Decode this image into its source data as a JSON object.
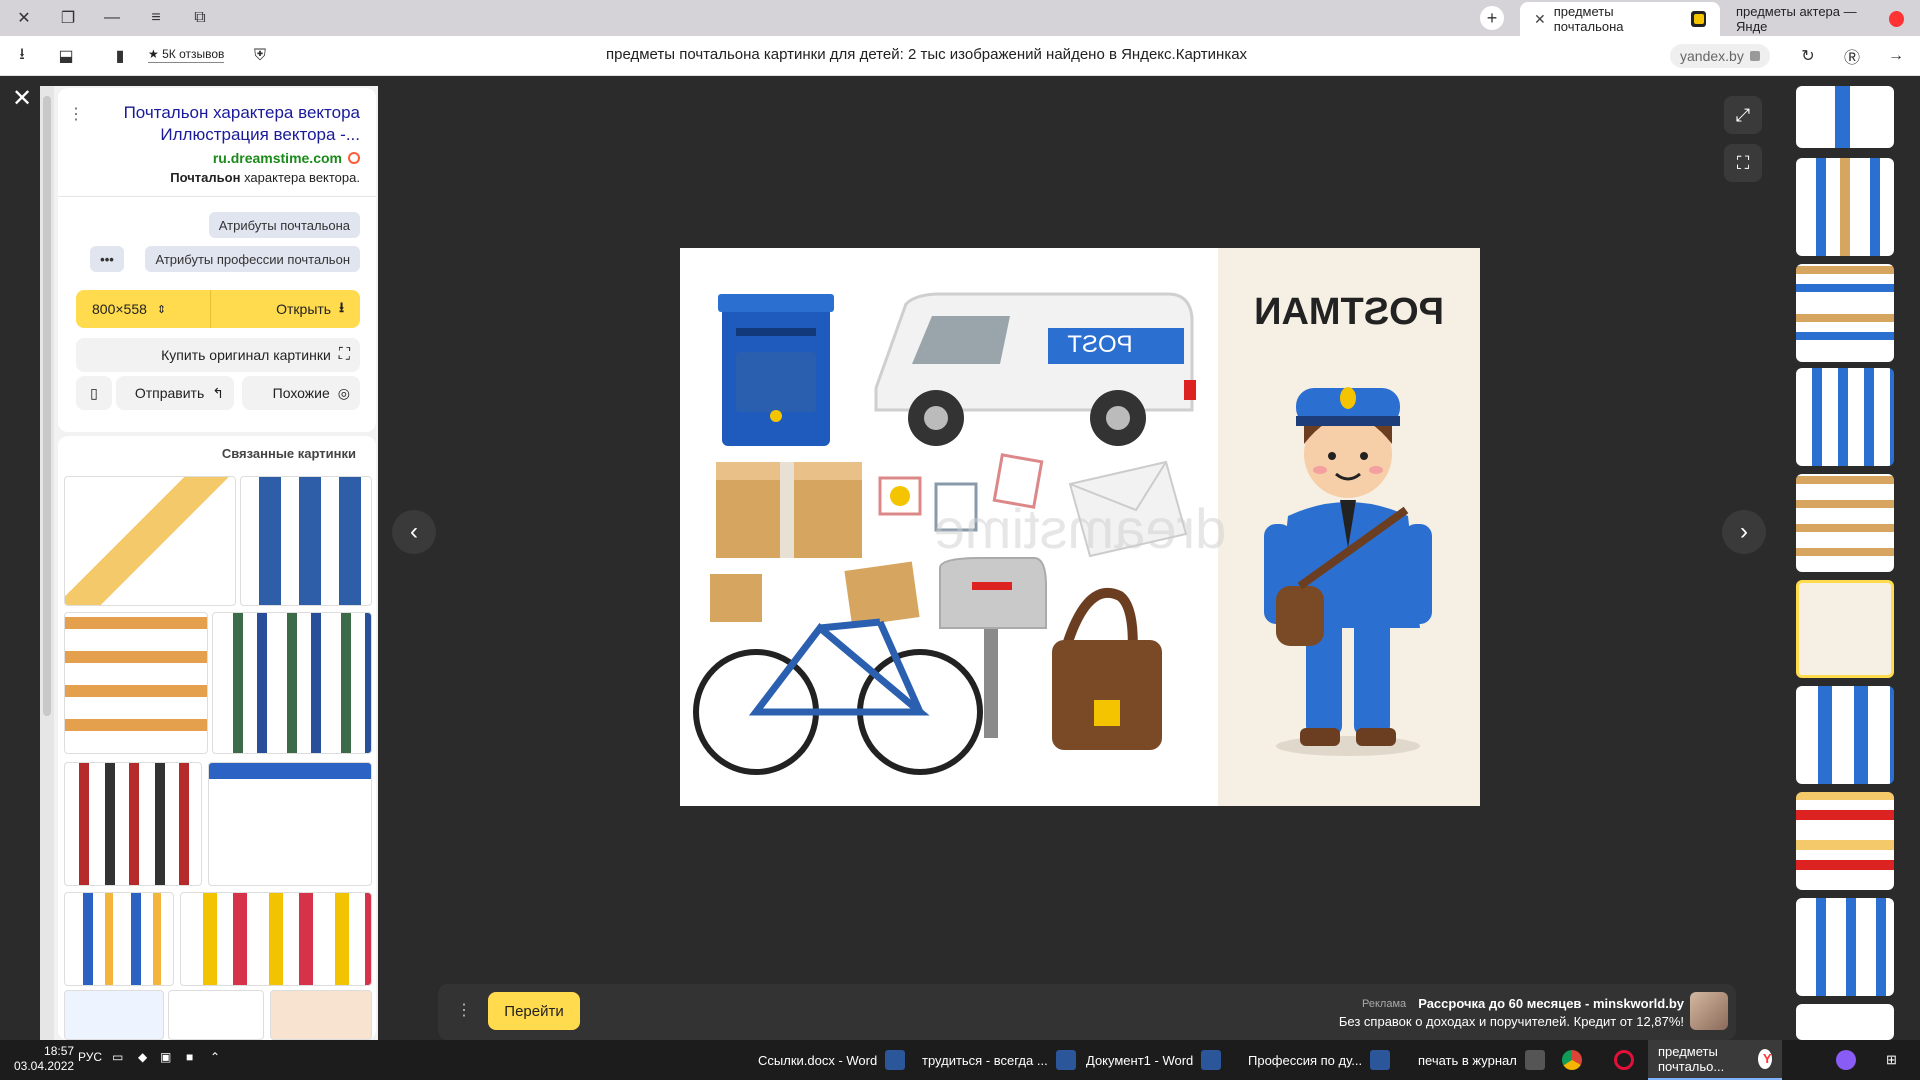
{
  "browser": {
    "tabs": [
      {
        "title": "предметы почтальона",
        "active": true
      },
      {
        "title": "предметы актера — Янде",
        "active": false
      }
    ],
    "page_title": "предметы почтальона картинки для детей: 2 тыс изображений найдено в Яндекс.Картинках",
    "url": "yandex.by",
    "reviews_label": "★ 5К отзывов"
  },
  "info": {
    "title": "Почтальон характера вектора Иллюстрация вектора -...",
    "source": "ru.dreamstime.com",
    "description_bold": "Почтальон",
    "description_rest": " характера вектора.",
    "tags": [
      "Атрибуты почтальона",
      "Атрибуты профессии почтальон"
    ],
    "more": "•••",
    "open_label": "Открыть",
    "size_label": "800×558",
    "buy_label": "Купить оригинал картинки",
    "similar_label": "Похожие",
    "share_label": "Отправить"
  },
  "related": {
    "title": "Связанные картинки"
  },
  "main_image": {
    "heading": "POSTMAN",
    "van_label": "POST",
    "watermark": "dreamstime"
  },
  "ad": {
    "go_label": "Перейти",
    "line1": "Рассрочка до 60 месяцев - minskworld.by",
    "tag": "Реклама",
    "line2": "Без справок о доходах и поручителей. Кредит от 12,87%!"
  },
  "taskbar": {
    "items": [
      {
        "label": "предметы почтальо...",
        "active": true
      },
      {
        "label": "печать в журнал",
        "active": false
      },
      {
        "label": "Профессия по ду...",
        "active": false
      },
      {
        "label": "Документ1 - Word",
        "active": false
      },
      {
        "label": "трудиться - всегда ...",
        "active": false
      },
      {
        "label": "Ссылки.docx - Word",
        "active": false
      }
    ],
    "time": "18:57",
    "date": "03.04.2022",
    "lang": "РУС"
  }
}
